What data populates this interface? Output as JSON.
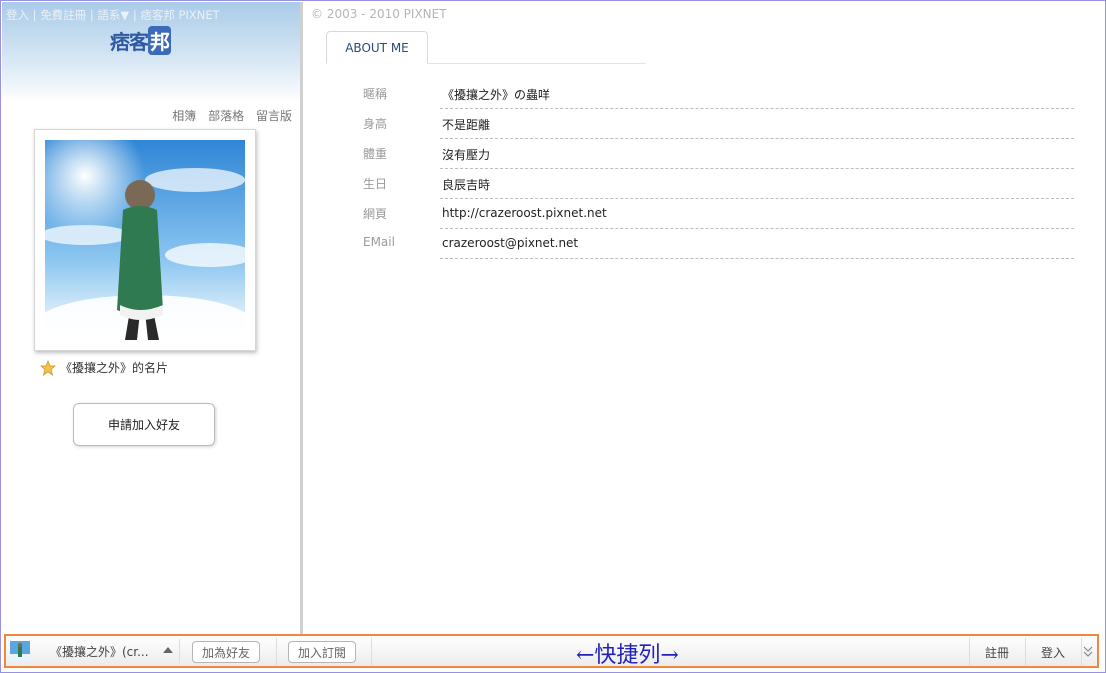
{
  "top_links": {
    "login": "登入",
    "register": "免費註冊",
    "language": "語系▼",
    "brand": "痞客邦 PIXNET"
  },
  "logo": {
    "text": "痞客",
    "bubble": "邦"
  },
  "side_nav": [
    "相簿",
    "部落格",
    "留言版"
  ],
  "card_caption": "《擾攘之外》的名片",
  "add_friend_button": "申請加入好友",
  "copyright": "© 2003 - 2010 PIXNET",
  "tab": {
    "about_label": "ABOUT ME"
  },
  "profile_rows": [
    {
      "label": "暱稱",
      "value": "《擾攘之外》の蟲咩"
    },
    {
      "label": "身高",
      "value": "不是距離"
    },
    {
      "label": "體重",
      "value": "沒有壓力"
    },
    {
      "label": "生日",
      "value": "良辰吉時"
    },
    {
      "label": "網頁",
      "value": "http://crazeroost.pixnet.net"
    },
    {
      "label": "EMail",
      "value": "crazeroost@pixnet.net"
    }
  ],
  "quickbar": {
    "blog_select": "《擾攘之外》(cr...",
    "add_friend": "加為好友",
    "subscribe": "加入訂閱",
    "label": "←快捷列→",
    "register": "註冊",
    "login": "登入"
  },
  "colors": {
    "frame_border": "#9a90e0",
    "quickbar_border": "#f0883e",
    "quickbar_label": "#2222bb",
    "logo_blue": "#2f5aa3"
  }
}
